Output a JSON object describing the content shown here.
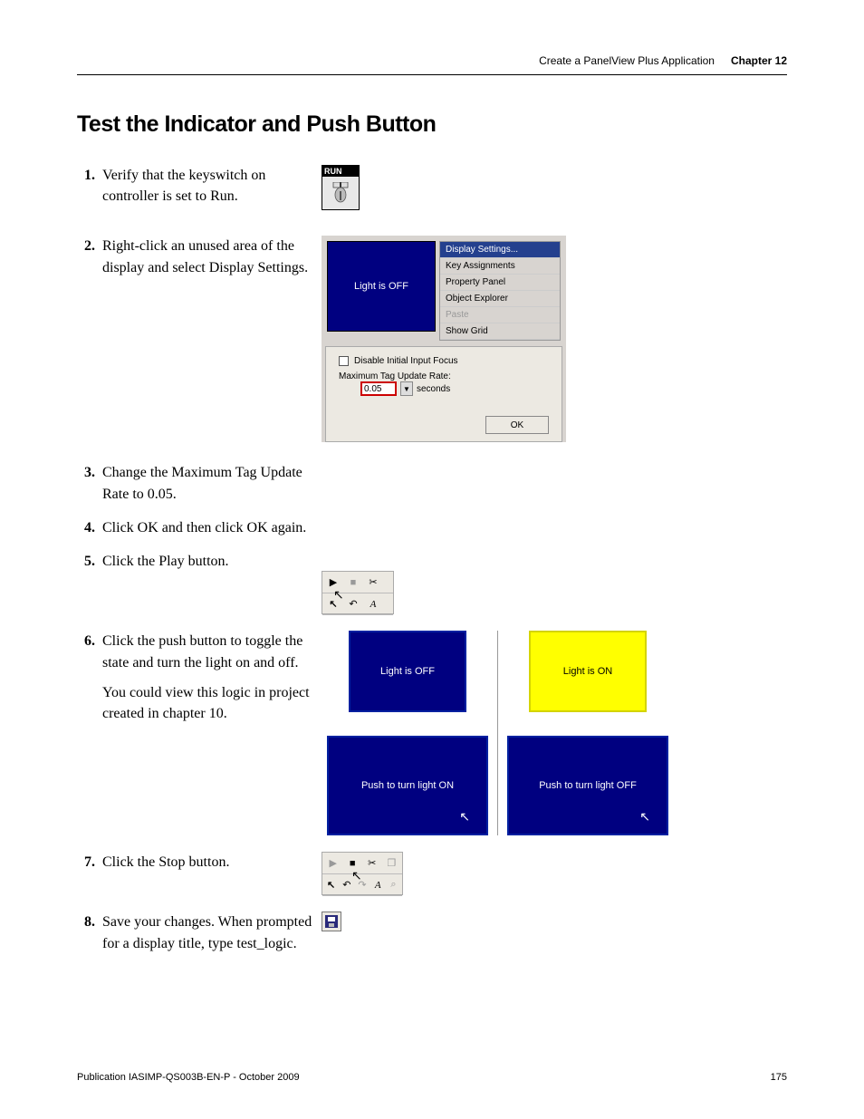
{
  "header": {
    "title": "Create a PanelView Plus Application",
    "chapter": "Chapter 12"
  },
  "section_title": "Test the Indicator and Push Button",
  "steps": {
    "s1": {
      "num": "1.",
      "text": "Verify that the keyswitch on controller is set to Run."
    },
    "s2": {
      "num": "2.",
      "text": "Right-click an unused area of the display and select Display Settings."
    },
    "s3": {
      "num": "3.",
      "text": "Change the Maximum Tag Update Rate to 0.05."
    },
    "s4": {
      "num": "4.",
      "text": "Click OK and then click OK again."
    },
    "s5": {
      "num": "5.",
      "text": "Click the Play button."
    },
    "s6": {
      "num": "6.",
      "text": "Click the push button to toggle the state and turn the light on and off.",
      "sub": "You could view this logic in project created in chapter 10."
    },
    "s7": {
      "num": "7.",
      "text": "Click the Stop button."
    },
    "s8": {
      "num": "8.",
      "text": "Save your changes. When prompted for a display title, type test_logic."
    }
  },
  "fig_run": {
    "label": "RUN"
  },
  "fig_ds": {
    "indicator": "Light is OFF",
    "menu": {
      "m0": "Display Settings...",
      "m1": "Key Assignments",
      "m2": "Property Panel",
      "m3": "Object Explorer",
      "m4": "Paste",
      "m5": "Show Grid"
    },
    "disable_focus": "Disable Initial Input Focus",
    "rate_label": "Maximum Tag Update Rate:",
    "rate_value": "0.05",
    "rate_unit": "seconds",
    "ok": "OK"
  },
  "fig_states": {
    "off_ind": "Light is OFF",
    "on_ind": "Light is ON",
    "off_btn": "Push to turn light ON",
    "on_btn": "Push to turn light OFF"
  },
  "footer": {
    "pub": "Publication IASIMP-QS003B-EN-P - October 2009",
    "page": "175"
  }
}
